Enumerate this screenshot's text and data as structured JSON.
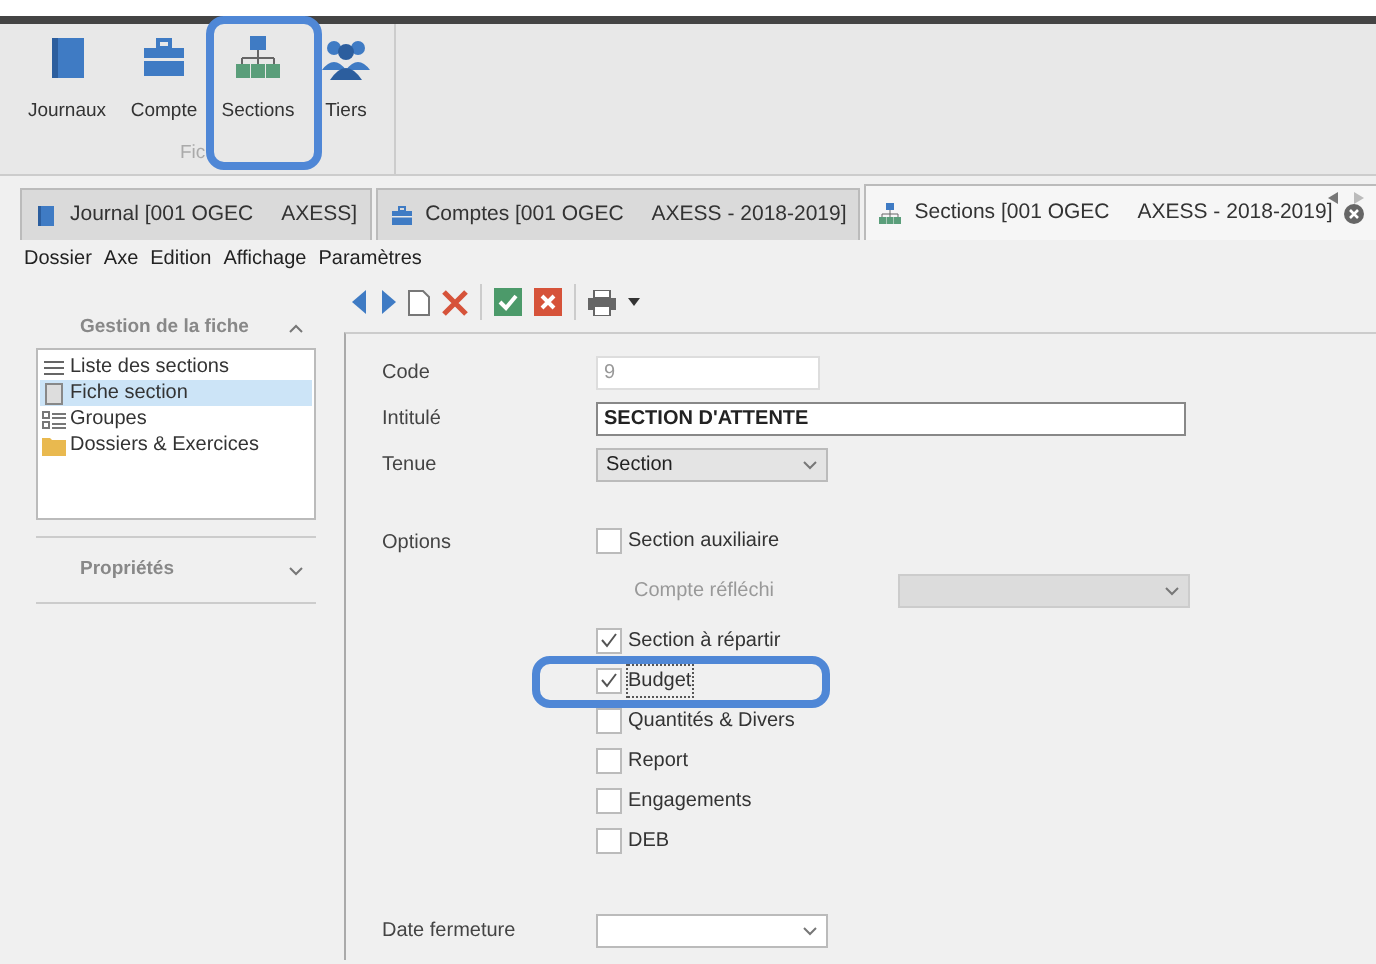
{
  "ribbon": {
    "group_label": "Fic",
    "buttons": [
      {
        "label": "Journaux"
      },
      {
        "label": "Compte"
      },
      {
        "label": "Sections"
      },
      {
        "label": "Tiers"
      }
    ]
  },
  "tabs": [
    {
      "label": "Journal [001 OGEC     AXESS]",
      "selected": false
    },
    {
      "label": "Comptes [001 OGEC     AXESS - 2018-2019]",
      "selected": false
    },
    {
      "label": "Sections [001 OGEC     AXESS - 2018-2019]",
      "selected": true
    }
  ],
  "menu": [
    "Dossier",
    "Axe",
    "Edition",
    "Affichage",
    "Paramètres"
  ],
  "side_panel": [
    {
      "title": "Gestion de la fiche",
      "expanded": true,
      "items": [
        {
          "label": "Liste des sections",
          "selected": false
        },
        {
          "label": "Fiche section",
          "selected": true
        },
        {
          "label": "Groupes",
          "selected": false
        },
        {
          "label": "Dossiers & Exercices",
          "selected": false
        }
      ]
    },
    {
      "title": "Propriétés",
      "expanded": false
    }
  ],
  "form": [
    {
      "kind": "text",
      "label": "Code",
      "value": "9",
      "disabled": true
    },
    {
      "kind": "text",
      "label": "Intitulé",
      "value": "SECTION D'ATTENTE",
      "disabled": false
    },
    {
      "kind": "select",
      "label": "Tenue",
      "value": "Section",
      "disabled": false
    },
    {
      "kind": "options",
      "label": "Options",
      "items": [
        {
          "kind": "checkbox",
          "label": "Section auxiliaire",
          "checked": false,
          "focused": false
        },
        {
          "kind": "select",
          "label": "Compte réfléchi",
          "disabled": true
        },
        {
          "kind": "checkbox",
          "label": "Section à répartir",
          "checked": true,
          "focused": false
        },
        {
          "kind": "checkbox",
          "label": "Budget",
          "checked": true,
          "focused": true
        },
        {
          "kind": "checkbox",
          "label": "Quantités & Divers",
          "checked": false,
          "focused": false
        },
        {
          "kind": "checkbox",
          "label": "Report",
          "checked": false,
          "focused": false
        },
        {
          "kind": "checkbox",
          "label": "Engagements",
          "checked": false,
          "focused": false
        },
        {
          "kind": "checkbox",
          "label": "DEB",
          "checked": false,
          "focused": false
        }
      ]
    },
    {
      "kind": "select",
      "label": "Date fermeture",
      "disabled": false
    }
  ]
}
